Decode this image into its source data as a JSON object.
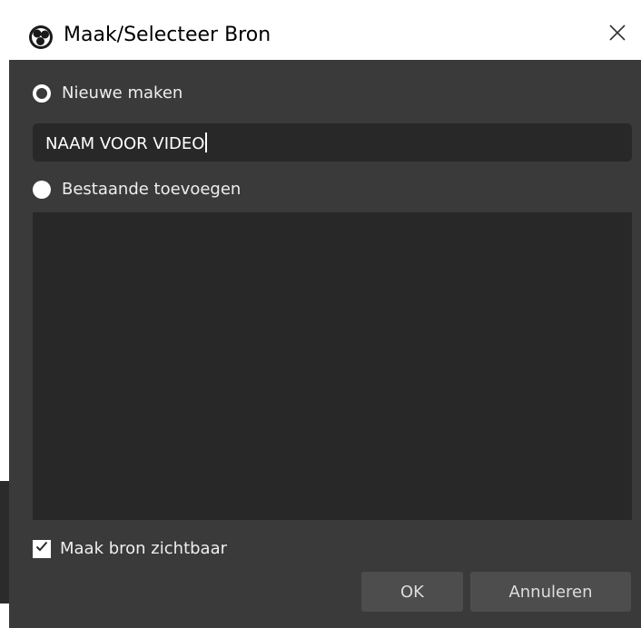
{
  "dialog": {
    "title": "Maak/Selecteer Bron",
    "close_symbol": "✕",
    "icons": {
      "app": "obs-logo-icon",
      "close": "close-icon",
      "check": "checkmark-icon"
    }
  },
  "source": {
    "new_label": "Nieuwe maken",
    "name_value": "NAAM VOOR VIDEO",
    "existing_label": "Bestaande toevoegen",
    "existing_items": []
  },
  "visible": {
    "label": "Maak bron zichtbaar",
    "checked": true
  },
  "buttons": {
    "ok": "OK",
    "cancel": "Annuleren"
  },
  "colors": {
    "dialog_bg": "#3a3a3a",
    "field_bg": "#282828",
    "button_bg": "#4d4d4d",
    "text": "#eeeeee"
  }
}
